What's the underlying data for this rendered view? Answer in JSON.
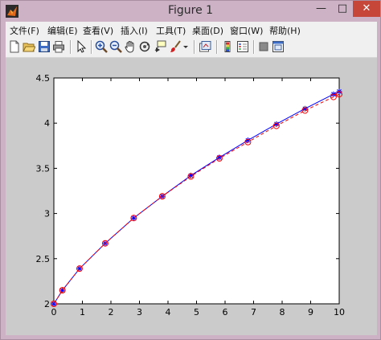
{
  "window": {
    "title": "Figure 1",
    "controls": {
      "minimize": "—",
      "maximize": "□",
      "close": "✕"
    }
  },
  "menubar": {
    "items": [
      "文件(F)",
      "编辑(E)",
      "查看(V)",
      "插入(I)",
      "工具(T)",
      "桌面(D)",
      "窗口(W)",
      "帮助(H)"
    ]
  },
  "toolbar": {
    "icons": [
      "new-figure-icon",
      "open-file-icon",
      "save-icon",
      "print-icon",
      "pointer-icon",
      "zoom-in-icon",
      "zoom-out-icon",
      "pan-hand-icon",
      "rotate-3d-icon",
      "data-cursor-icon",
      "brush-icon",
      "brush-dropdown-icon",
      "link-plot-icon",
      "colorbar-icon",
      "legend-icon",
      "hide-plot-tools-icon",
      "show-plot-tools-icon"
    ]
  },
  "chart_data": {
    "type": "line",
    "title": "",
    "xlabel": "",
    "ylabel": "",
    "xlim": [
      0,
      10
    ],
    "ylim": [
      2,
      4.5
    ],
    "xticks": [
      "0",
      "1",
      "2",
      "3",
      "4",
      "5",
      "6",
      "7",
      "8",
      "9",
      "10"
    ],
    "yticks": [
      "2",
      "2.5",
      "3",
      "3.5",
      "4",
      "4.5"
    ],
    "grid": false,
    "series": [
      {
        "style": "solid line with * markers",
        "color": "#0000ff",
        "x": [
          0,
          0.3,
          0.9,
          1.8,
          2.8,
          3.8,
          4.8,
          5.8,
          6.8,
          7.8,
          8.8,
          9.8,
          10
        ],
        "y": [
          2.0,
          2.15,
          2.39,
          2.67,
          2.95,
          3.19,
          3.42,
          3.62,
          3.81,
          3.99,
          4.16,
          4.32,
          4.35
        ]
      },
      {
        "style": "dashed line with o markers",
        "color": "#ff0000",
        "x": [
          0,
          0.3,
          0.9,
          1.8,
          2.8,
          3.8,
          4.8,
          5.8,
          6.8,
          7.8,
          8.8,
          9.8,
          10
        ],
        "y": [
          2.0,
          2.15,
          2.39,
          2.67,
          2.95,
          3.19,
          3.41,
          3.61,
          3.79,
          3.97,
          4.14,
          4.29,
          4.32
        ]
      }
    ]
  }
}
